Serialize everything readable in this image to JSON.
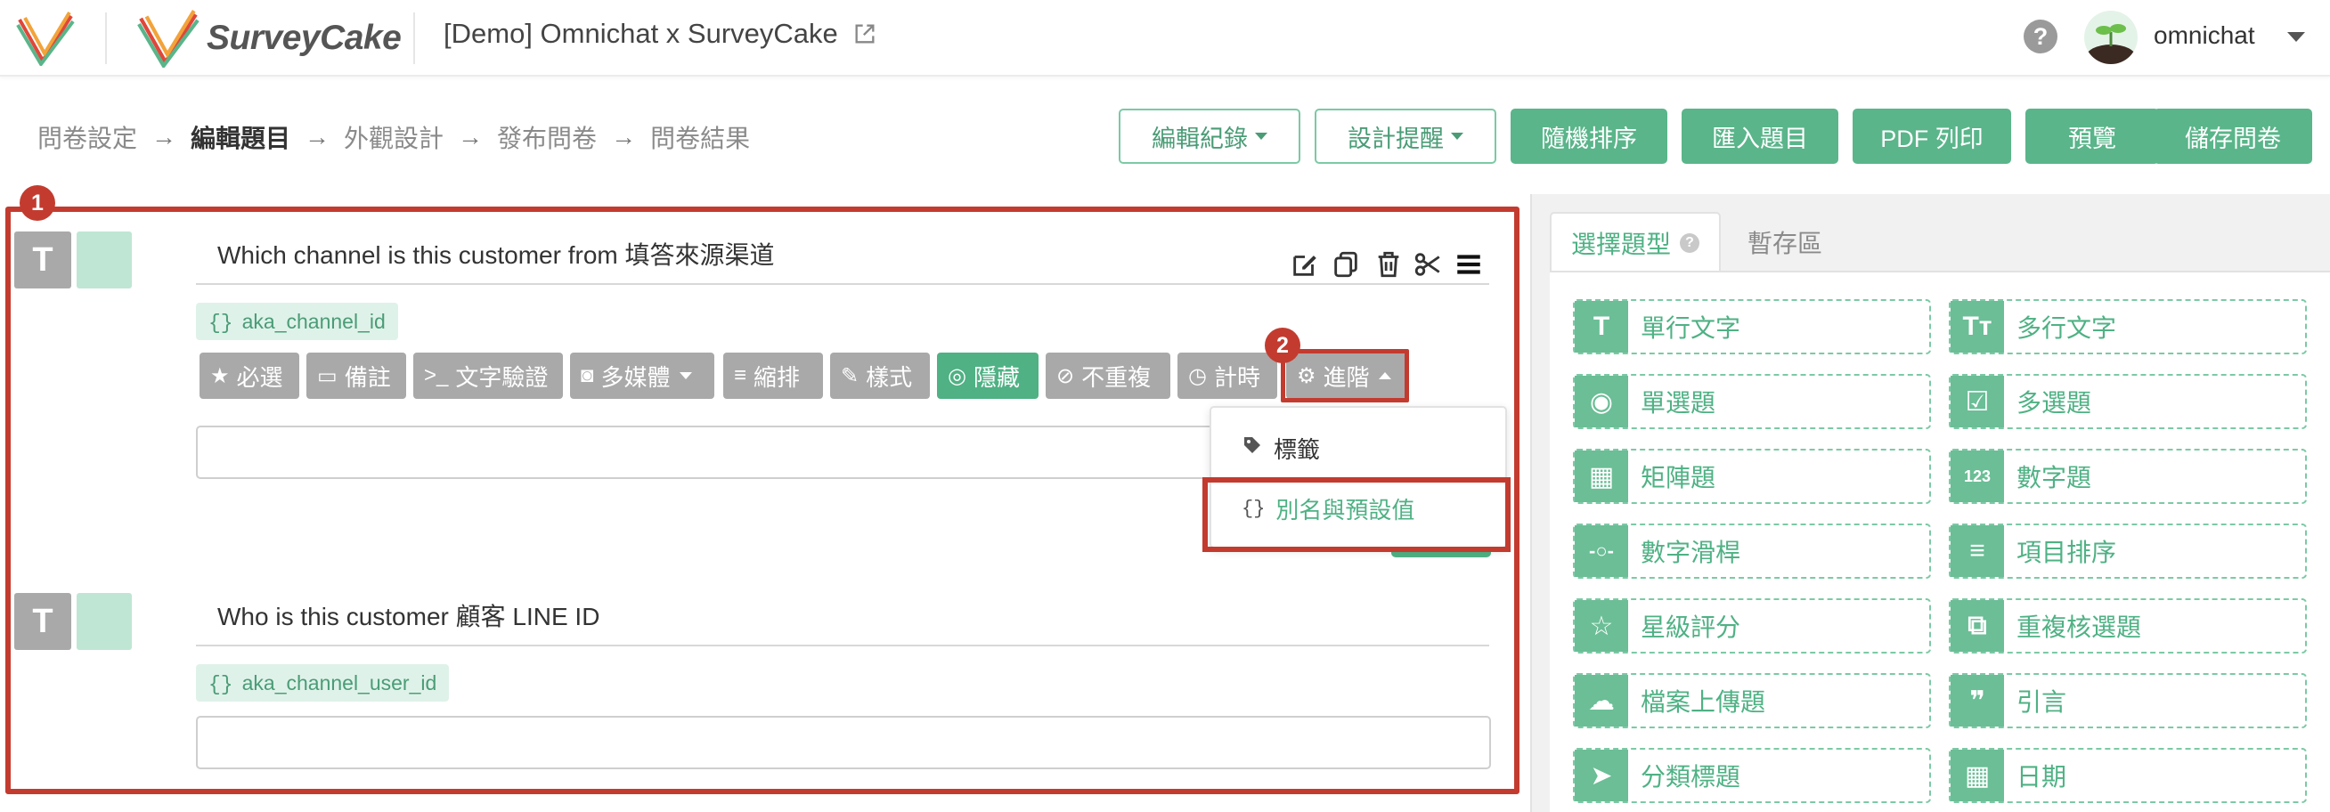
{
  "header": {
    "brand": "SurveyCake",
    "survey_title": "[Demo] Omnichat x SurveyCake",
    "username": "omnichat",
    "help": "?"
  },
  "steps": [
    "問卷設定",
    "編輯題目",
    "外觀設計",
    "發布問卷",
    "問卷結果"
  ],
  "active_step": "編輯題目",
  "step_arrow": "→",
  "toolbar": {
    "edit_log": "編輯紀錄",
    "design_tips": "設計提醒",
    "random_order": "隨機排序",
    "import": "匯入題目",
    "pdf": "PDF 列印",
    "preview": "預覽",
    "save": "儲存問卷"
  },
  "annotations": {
    "badge1": "1",
    "badge2": "2"
  },
  "questions": [
    {
      "type_letter": "T",
      "title": "Which channel is this customer from 填答來源渠道",
      "alias": "aka_channel_id"
    },
    {
      "type_letter": "T",
      "title": "Who is this customer 顧客 LINE ID",
      "alias": "aka_channel_user_id"
    }
  ],
  "alias_brace": "{}",
  "options": {
    "required": "必選",
    "note": "備註",
    "validation": "文字驗證",
    "media": "多媒體",
    "indent": "縮排",
    "style": "樣式",
    "hide": "隱藏",
    "no_repeat": "不重複",
    "timer": "計時",
    "advanced": "進階"
  },
  "dropdown": {
    "tag": "標籤",
    "alias_default": "別名與預設值"
  },
  "right_panel": {
    "tab_types": "選擇題型",
    "tab_storage": "暫存區",
    "types": [
      {
        "icon": "T",
        "label": "單行文字"
      },
      {
        "icon": "Tт",
        "label": "多行文字"
      },
      {
        "icon": "◉",
        "label": "單選題"
      },
      {
        "icon": "☑",
        "label": "多選題"
      },
      {
        "icon": "▦",
        "label": "矩陣題"
      },
      {
        "icon": "123",
        "label": "數字題"
      },
      {
        "icon": "-○-",
        "label": "數字滑桿"
      },
      {
        "icon": "≡",
        "label": "項目排序"
      },
      {
        "icon": "☆",
        "label": "星級評分"
      },
      {
        "icon": "⧉",
        "label": "重複核選題"
      },
      {
        "icon": "☁",
        "label": "檔案上傳題"
      },
      {
        "icon": "❞",
        "label": "引言"
      },
      {
        "icon": "➤",
        "label": "分類標題"
      },
      {
        "icon": "▦",
        "label": "日期"
      }
    ]
  },
  "colors": {
    "accent": "#4fb184",
    "annotation_red": "#c33b2f",
    "gray_option": "#a9a9a9"
  }
}
